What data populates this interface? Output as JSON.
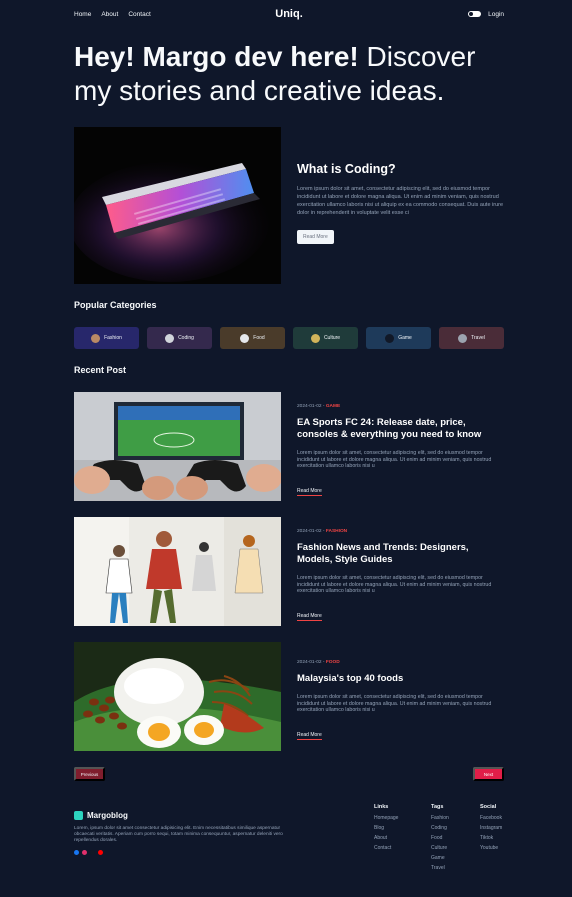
{
  "nav": {
    "links": [
      "Home",
      "About",
      "Contact"
    ],
    "brand": "Uniq.",
    "login": "Login"
  },
  "hero": {
    "bold": "Hey! Margo dev here!",
    "light": "Discover my stories and creative ideas."
  },
  "featured": {
    "title": "What is Coding?",
    "body": "Lorem ipsum dolor sit amet, consectetur adipiscing elit, sed do eiusmod tempor incididunt ut labore et dolore magna aliqua. Ut enim ad minim veniam, quis nostrud exercitation ullamco laboris nisi ut aliquip ex ea commodo consequat. Duis aute irure dolor in reprehenderit in voluptate velit esse ci",
    "button": "Read More"
  },
  "categories": {
    "title": "Popular Categories",
    "items": [
      {
        "label": "Fashion",
        "bg": "#27276b",
        "icon": "#b98965"
      },
      {
        "label": "Coding",
        "bg": "#34294d",
        "icon": "#d1d5db"
      },
      {
        "label": "Food",
        "bg": "#4a3b2a",
        "icon": "#e5e7eb"
      },
      {
        "label": "Culture",
        "bg": "#1f3b3a",
        "icon": "#d1b45a"
      },
      {
        "label": "Game",
        "bg": "#1e3a5a",
        "icon": "#111827"
      },
      {
        "label": "Travel",
        "bg": "#4a2c38",
        "icon": "#9ca3af"
      }
    ]
  },
  "recent": {
    "title": "Recent Post",
    "posts": [
      {
        "date": "2024-01-02 -",
        "cat": "GAME",
        "title": "EA Sports FC 24: Release date, price, consoles & everything you need to know",
        "body": "Lorem ipsum dolor sit amet, consectetur adipiscing elit, sed do eiusmod tempor incididunt ut labore et dolore magna aliqua. Ut enim ad minim veniam, quis nostrud exercitation ullamco laboris nisi u",
        "more": "Read More"
      },
      {
        "date": "2024-01-02 -",
        "cat": "FASHION",
        "title": "Fashion News and Trends: Designers, Models, Style Guides",
        "body": "Lorem ipsum dolor sit amet, consectetur adipiscing elit, sed do eiusmod tempor incididunt ut labore et dolore magna aliqua. Ut enim ad minim veniam, quis nostrud exercitation ullamco laboris nisi u",
        "more": "Read More"
      },
      {
        "date": "2024-01-02 -",
        "cat": "FOOD",
        "title": "Malaysia's top 40 foods",
        "body": "Lorem ipsum dolor sit amet, consectetur adipiscing elit, sed do eiusmod tempor incididunt ut labore et dolore magna aliqua. Ut enim ad minim veniam, quis nostrud exercitation ullamco laboris nisi u",
        "more": "Read More"
      }
    ]
  },
  "pager": {
    "prev": "Previous",
    "next": "Next"
  },
  "footer": {
    "brand": "Margoblog",
    "desc": "Lorem, ipsum dolor sit amet consectetur adipisicing elit. Enim necessitatibus similique aspernatur obcaecati veritatis. Aperiam cum porro sequi, totam minima consequuntur, aspernatur deleniti vero repellendus dorales.",
    "socials": [
      "#1877f2",
      "#e1306c",
      "#111827",
      "#ff0000"
    ],
    "links": {
      "title": "Links",
      "items": [
        "Homepage",
        "Blog",
        "About",
        "Contact"
      ]
    },
    "tags": {
      "title": "Tags",
      "items": [
        "Fashion",
        "Coding",
        "Food",
        "Culture",
        "Game",
        "Travel"
      ]
    },
    "social": {
      "title": "Social",
      "items": [
        "Facebook",
        "Instagram",
        "Tiktok",
        "Youtube"
      ]
    }
  }
}
